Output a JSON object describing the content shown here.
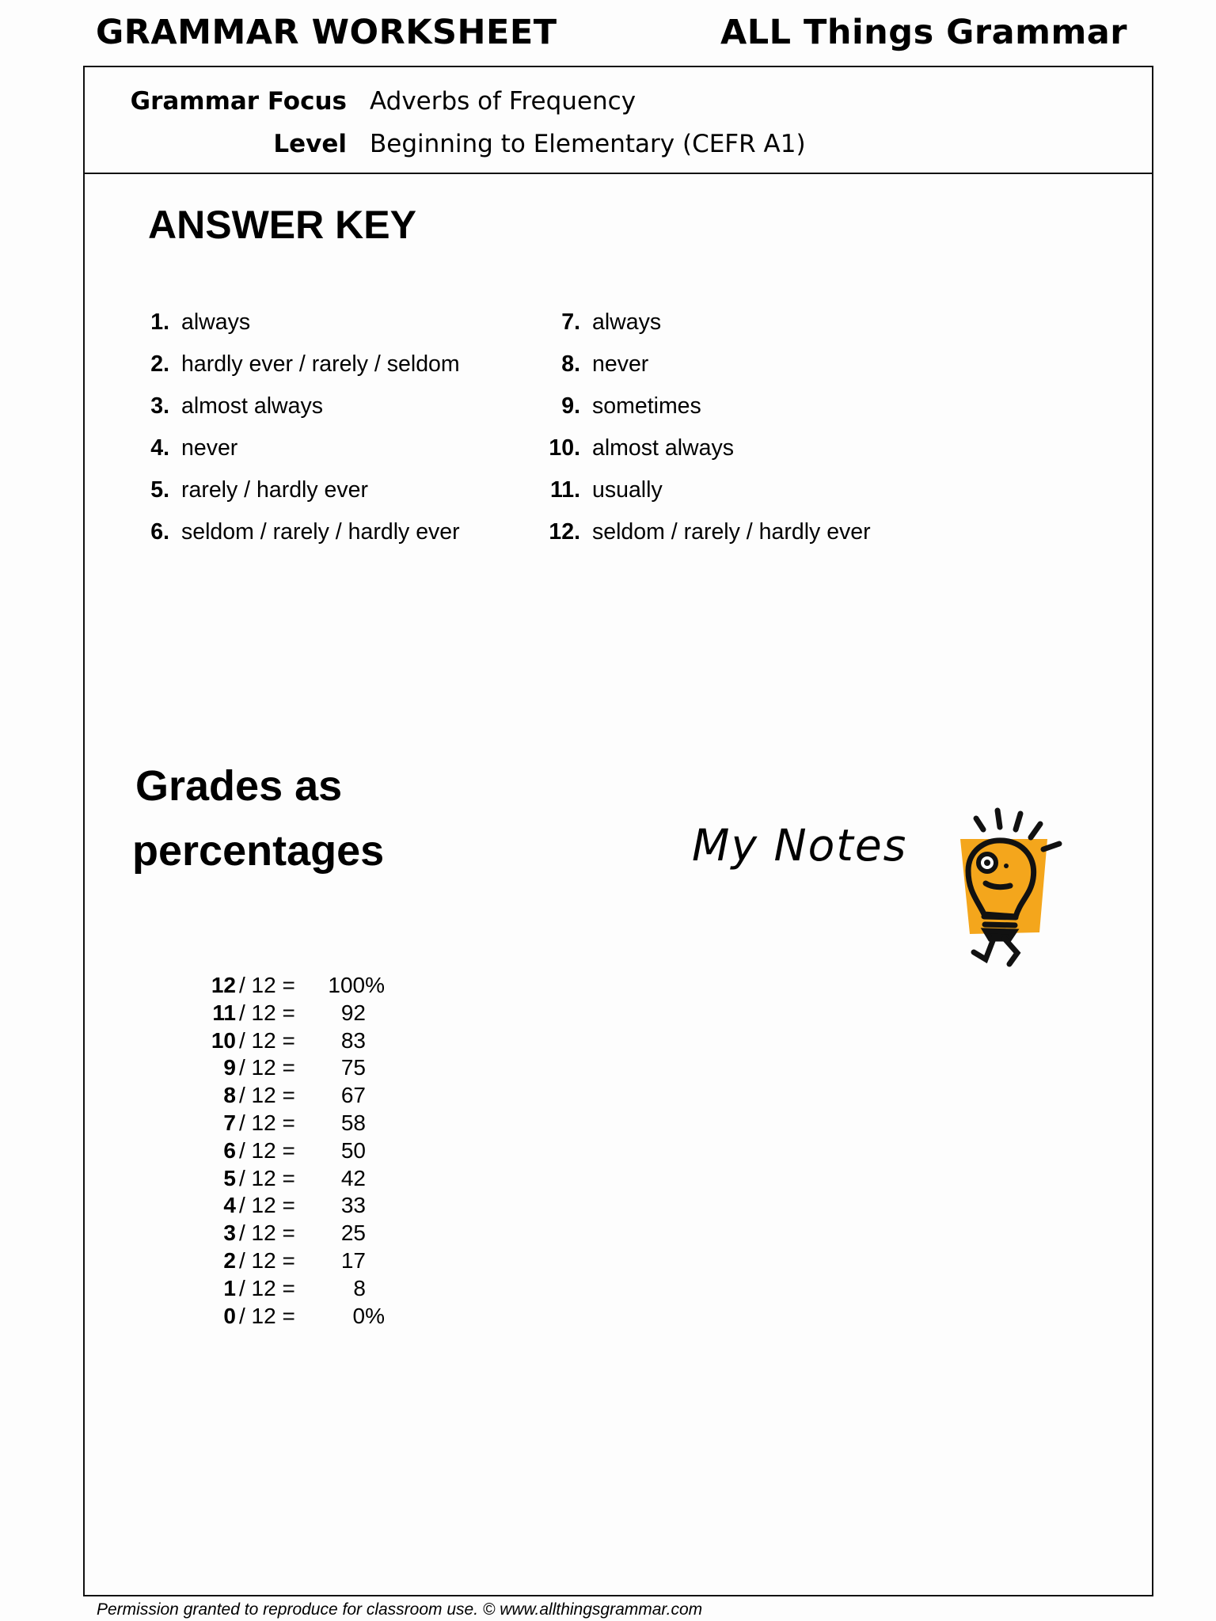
{
  "header": {
    "title_left": "GRAMMAR WORKSHEET",
    "title_right": "ALL Things Grammar"
  },
  "meta": {
    "focus_label": "Grammar Focus",
    "focus_value": "Adverbs of Frequency",
    "level_label": "Level",
    "level_value": "Beginning to Elementary  (CEFR A1)"
  },
  "answer_key": {
    "heading": "ANSWER KEY",
    "answers": [
      {
        "num": "1.",
        "text": "always"
      },
      {
        "num": "2.",
        "text": "hardly ever / rarely / seldom"
      },
      {
        "num": "3.",
        "text": "almost always"
      },
      {
        "num": "4.",
        "text": "never"
      },
      {
        "num": "5.",
        "text": "rarely / hardly ever"
      },
      {
        "num": "6.",
        "text": "seldom / rarely / hardly ever"
      },
      {
        "num": "7.",
        "text": "always"
      },
      {
        "num": "8.",
        "text": "never"
      },
      {
        "num": "9.",
        "text": "sometimes"
      },
      {
        "num": "10.",
        "text": "almost always"
      },
      {
        "num": "11.",
        "text": "usually"
      },
      {
        "num": "12.",
        "text": "seldom / rarely / hardly ever"
      }
    ]
  },
  "grades": {
    "heading_line1": "Grades as",
    "heading_line2": "percentages",
    "rows": [
      {
        "score": "12",
        "out_of": "/ 12 =",
        "percent": "100%"
      },
      {
        "score": "11",
        "out_of": "/ 12 =",
        "percent": "92"
      },
      {
        "score": "10",
        "out_of": "/ 12 =",
        "percent": "83"
      },
      {
        "score": "9",
        "out_of": "/ 12 =",
        "percent": "75"
      },
      {
        "score": "8",
        "out_of": "/ 12 =",
        "percent": "67"
      },
      {
        "score": "7",
        "out_of": "/ 12 =",
        "percent": "58"
      },
      {
        "score": "6",
        "out_of": "/ 12 =",
        "percent": "50"
      },
      {
        "score": "5",
        "out_of": "/ 12 =",
        "percent": "42"
      },
      {
        "score": "4",
        "out_of": "/ 12 =",
        "percent": "33"
      },
      {
        "score": "3",
        "out_of": "/ 12 =",
        "percent": "25"
      },
      {
        "score": "2",
        "out_of": "/ 12 =",
        "percent": "17"
      },
      {
        "score": "1",
        "out_of": "/ 12 =",
        "percent": "8"
      },
      {
        "score": "0",
        "out_of": "/ 12 =",
        "percent": "0%"
      }
    ]
  },
  "notes": {
    "heading": "My Notes",
    "icon": "lightbulb-character-icon",
    "accent_color": "#f4a61c"
  },
  "footer": {
    "text": "Permission granted to reproduce for classroom use.  © www.allthingsgrammar.com"
  }
}
